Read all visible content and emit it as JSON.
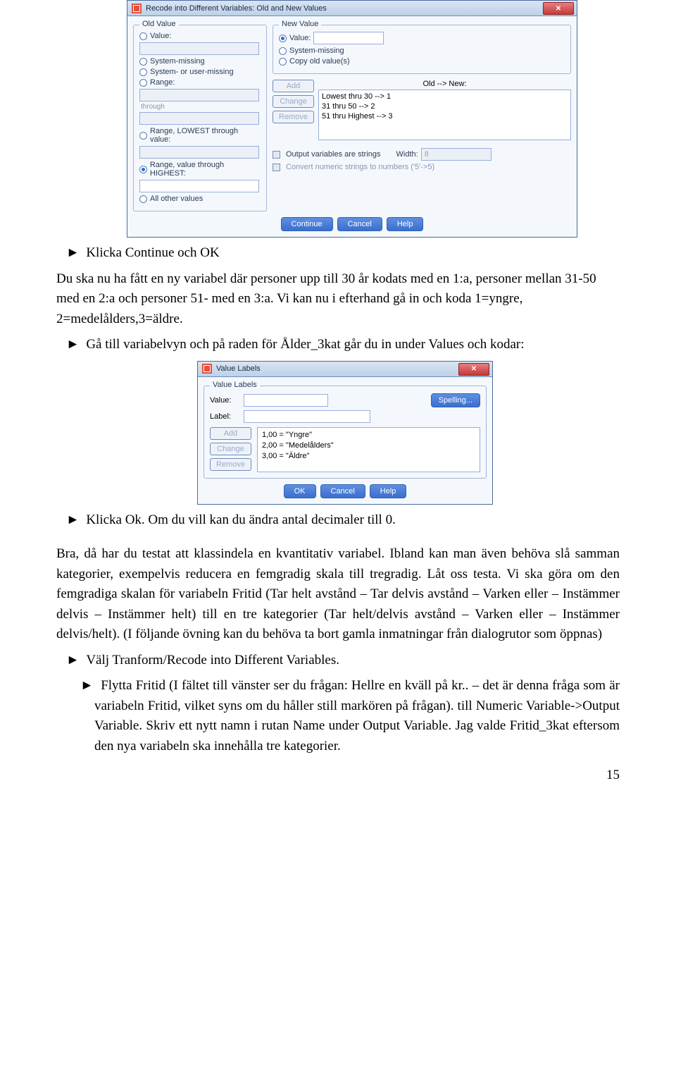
{
  "recode": {
    "title": "Recode into Different Variables: Old and New Values",
    "old_value_legend": "Old Value",
    "new_value_legend": "New Value",
    "value_label": "Value:",
    "system_missing": "System-missing",
    "system_or_user_missing": "System- or user-missing",
    "range_label": "Range:",
    "through": "through",
    "range_lowest": "Range, LOWEST through value:",
    "range_highest": "Range, value through HIGHEST:",
    "all_other_values": "All other values",
    "nv_value": "Value:",
    "nv_system_missing": "System-missing",
    "nv_copy": "Copy old value(s)",
    "old_new_label": "Old --> New:",
    "mappings": [
      "Lowest thru 30 --> 1",
      "31 thru 50 --> 2",
      "51 thru Highest --> 3"
    ],
    "add": "Add",
    "change": "Change",
    "remove": "Remove",
    "output_strings": "Output variables are strings",
    "width_label": "Width:",
    "width_value": "8",
    "convert_numeric": "Convert numeric strings to numbers ('5'->5)",
    "continue": "Continue",
    "cancel": "Cancel",
    "help": "Help"
  },
  "valuelabels": {
    "title": "Value Labels",
    "legend": "Value Labels",
    "value_label": "Value:",
    "label_label": "Label:",
    "spelling": "Spelling...",
    "add": "Add",
    "change": "Change",
    "remove": "Remove",
    "entries": [
      "1,00 = \"Yngre\"",
      "2,00 = \"Medelålders\"",
      "3,00 = \"Äldre\""
    ],
    "ok": "OK",
    "cancel": "Cancel",
    "help": "Help"
  },
  "text": {
    "p1": "Klicka Continue och OK",
    "p2": "Du ska nu ha fått en ny variabel där personer upp till 30 år kodats med en 1:a, personer mellan 31-50 med en 2:a och personer 51- med en 3:a. Vi kan nu i efterhand gå in och koda 1=yngre, 2=medelålders,3=äldre.",
    "p3": "Gå till variabelvyn och på raden för Ålder_3kat går du in under Values och kodar:",
    "p4": "Klicka Ok. Om du vill kan du ändra antal decimaler till 0.",
    "p5": "Bra, då har du testat att klassindela en kvantitativ variabel. Ibland kan man även behöva slå samman kategorier, exempelvis reducera en femgradig skala till tregradig. Låt oss testa. Vi ska göra om den femgradiga skalan för variabeln Fritid (Tar helt avstånd – Tar delvis avstånd – Varken eller – Instämmer delvis – Instämmer helt) till en tre kategorier (Tar helt/delvis avstånd – Varken eller – Instämmer delvis/helt). (I följande övning kan du behöva ta bort gamla inmatningar från dialogrutor som öppnas)",
    "p6": "Välj Tranform/Recode into Different Variables.",
    "p7": "Flytta Fritid (I fältet till vänster ser du frågan: Hellre en kväll på kr.. – det är denna fråga som är variabeln Fritid, vilket syns om du håller still markören på frågan). till Numeric Variable->Output Variable. Skriv ett nytt namn i rutan Name under Output Variable. Jag valde Fritid_3kat eftersom den nya variabeln ska innehålla tre kategorier.",
    "page_num": "15"
  }
}
